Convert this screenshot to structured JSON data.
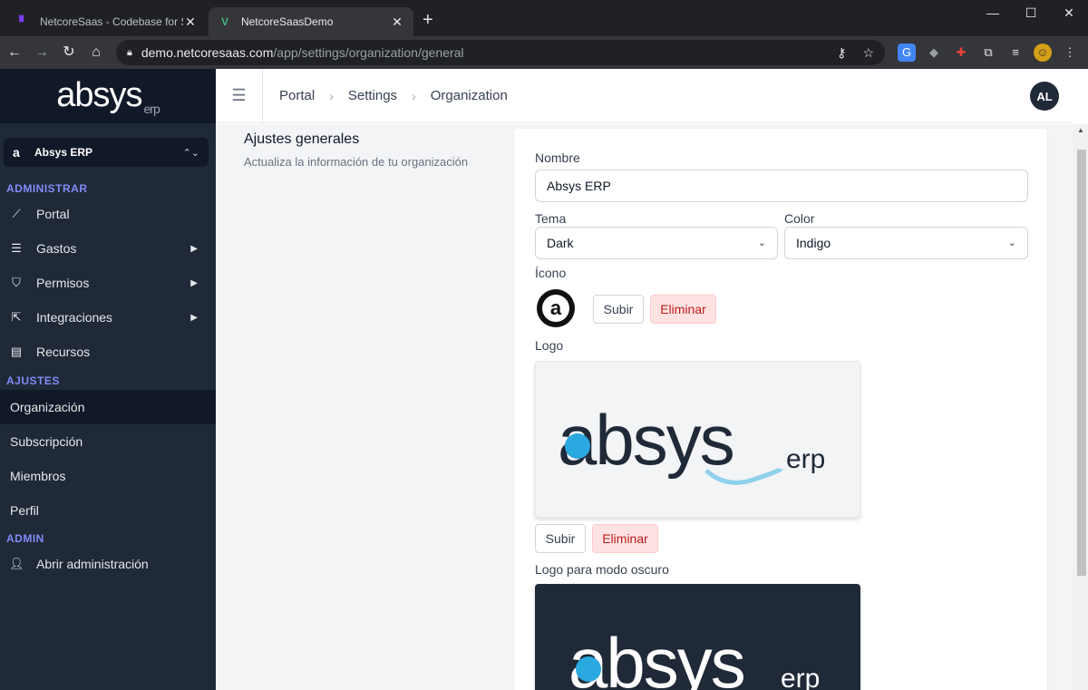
{
  "browser": {
    "tabs": [
      {
        "title": "NetcoreSaas - Codebase for SaaS",
        "icon": "netcoresaas-favicon"
      },
      {
        "title": "NetcoreSaasDemo",
        "icon": "vue-favicon"
      }
    ],
    "url": {
      "host": "demo.netcoresaas.com",
      "path": "/app/settings/organization/general"
    }
  },
  "app": {
    "brand": {
      "name": "absys",
      "suffix": "erp"
    },
    "org_selector": {
      "name": "Absys ERP"
    },
    "sections": {
      "administrar": "ADMINISTRAR",
      "ajustes": "AJUSTES",
      "admin": "ADMIN"
    },
    "nav": {
      "portal": "Portal",
      "gastos": "Gastos",
      "permisos": "Permisos",
      "integraciones": "Integraciones",
      "recursos": "Recursos",
      "organizacion": "Organización",
      "subscripcion": "Subscripción",
      "miembros": "Miembros",
      "perfil": "Perfil",
      "abrir_admin": "Abrir administración"
    },
    "breadcrumb": [
      "Portal",
      "Settings",
      "Organization"
    ],
    "avatar": "AL"
  },
  "settings": {
    "title": "Ajustes generales",
    "subtitle": "Actualiza la información de tu organización",
    "nombre_label": "Nombre",
    "nombre_value": "Absys ERP",
    "tema_label": "Tema",
    "tema_value": "Dark",
    "color_label": "Color",
    "color_value": "Indigo",
    "icono_label": "Ícono",
    "logo_label": "Logo",
    "logo_dark_label": "Logo para modo oscuro",
    "upload_label": "Subir",
    "delete_label": "Eliminar",
    "logo_text": "absys",
    "logo_suffix": "erp"
  },
  "colors": {
    "accent": "#818cf8",
    "sidebar": "#1f2937",
    "logo_blue": "#2aa8e0"
  }
}
